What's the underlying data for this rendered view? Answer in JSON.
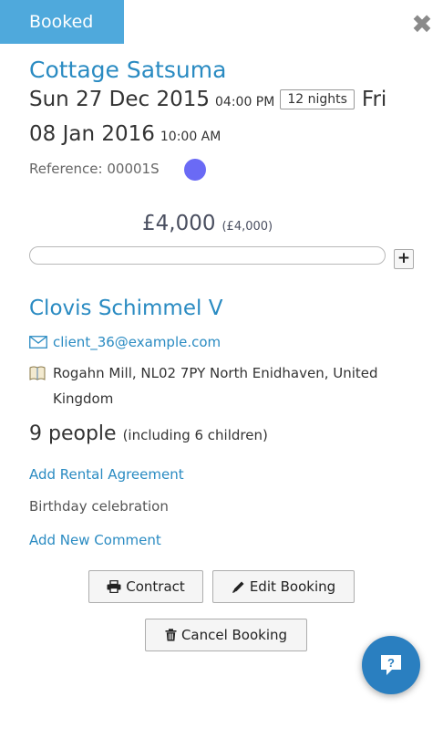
{
  "status": {
    "label": "Booked"
  },
  "close": {
    "glyph": "✖",
    "icon": "close-icon"
  },
  "booking": {
    "property_name": "Cottage Satsuma",
    "start_date": "Sun 27 Dec 2015",
    "start_time": "04:00 PM",
    "nights": "12 nights",
    "end_day": "Fri",
    "end_date": "08 Jan 2016",
    "end_time": "10:00 AM",
    "reference": "Reference: 00001S",
    "reference_color": "#6a6af5"
  },
  "price": {
    "main": "£4,000",
    "sub": "(£4,000)",
    "paid_fraction": 0,
    "add_label": "+"
  },
  "client": {
    "name": "Clovis Schimmel V",
    "email": "client_36@example.com",
    "address": "Rogahn Mill, NL02 7PY North Enidhaven, United Kingdom",
    "people_count": "9 people",
    "people_note": "(including 6 children)"
  },
  "links": {
    "rental_agreement": "Add Rental Agreement",
    "comment": "Birthday celebration",
    "add_comment": "Add New Comment"
  },
  "actions": {
    "contract": "Contract",
    "edit": "Edit Booking",
    "cancel": "Cancel Booking"
  },
  "help": {
    "label": "?",
    "icon": "chat-help-icon"
  },
  "colors": {
    "accent": "#4fa9dc",
    "link": "#2a8bc2",
    "help_button": "#2a7fc0"
  }
}
